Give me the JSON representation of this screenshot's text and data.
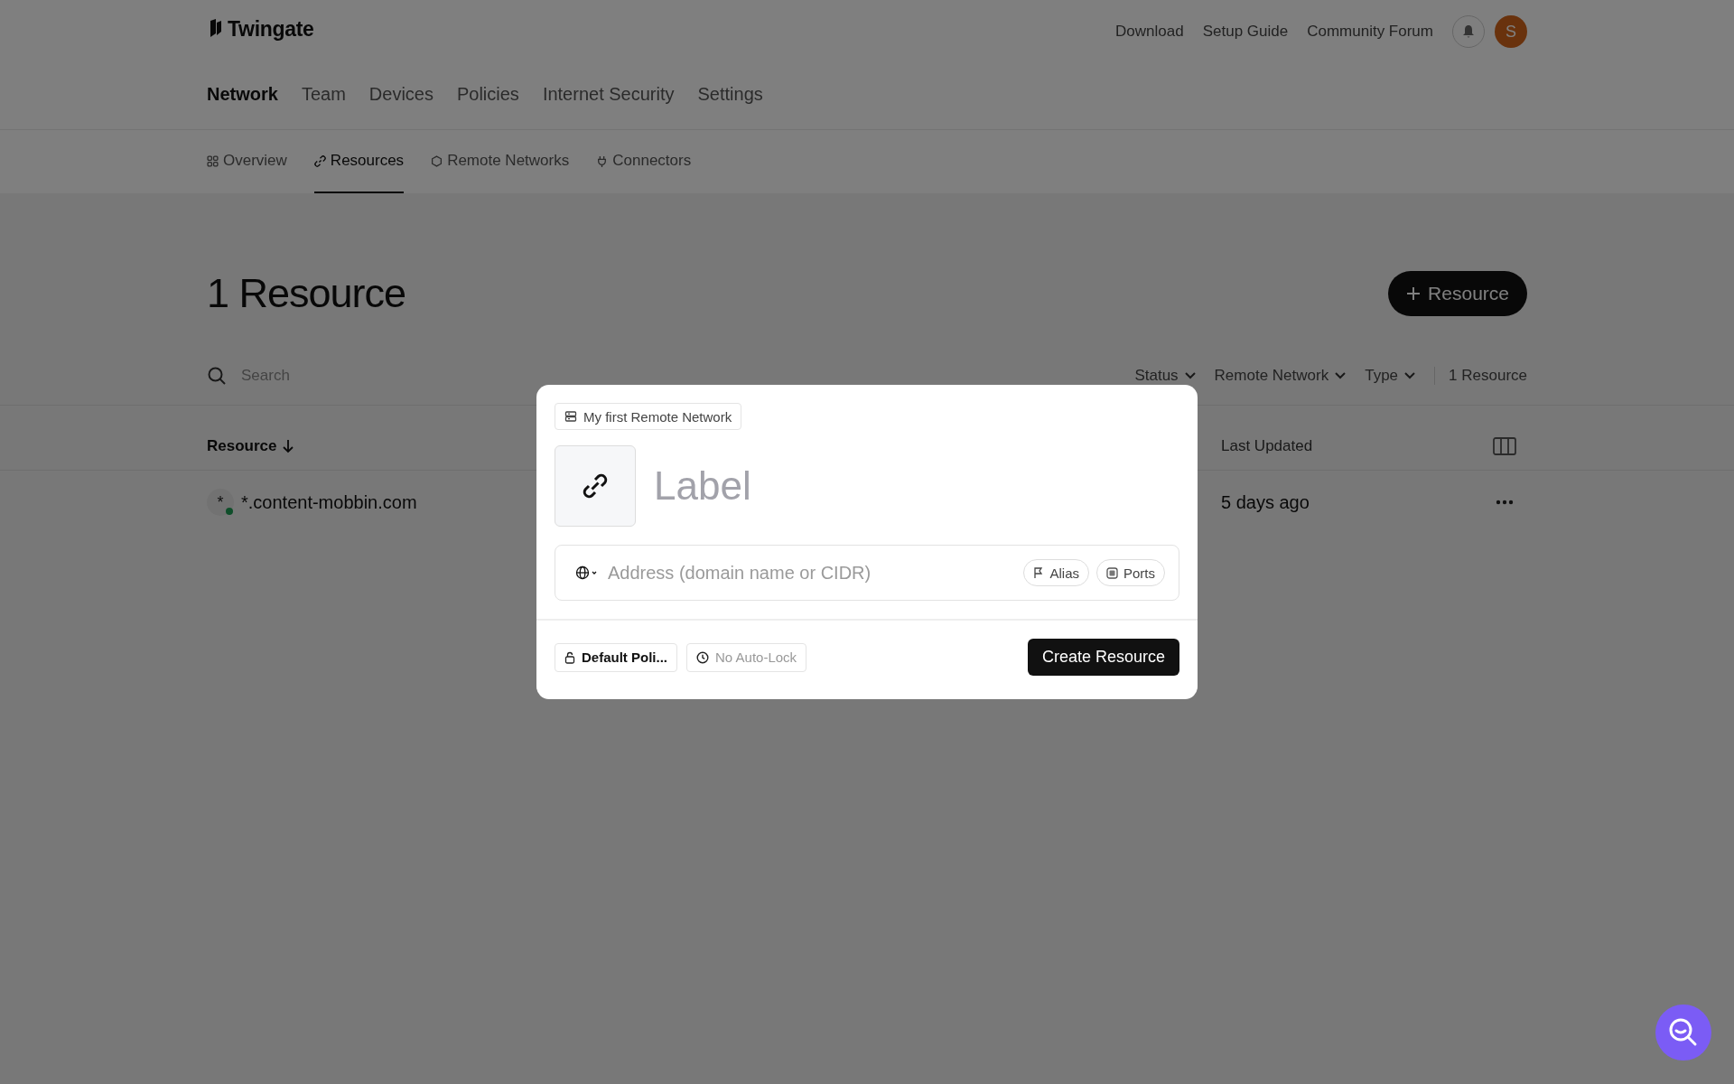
{
  "brand": {
    "name": "Twingate"
  },
  "top_links": [
    "Download",
    "Setup Guide",
    "Community Forum"
  ],
  "avatar": {
    "initial": "S"
  },
  "main_nav": [
    {
      "label": "Network",
      "selected": true
    },
    {
      "label": "Team",
      "selected": false
    },
    {
      "label": "Devices",
      "selected": false
    },
    {
      "label": "Policies",
      "selected": false
    },
    {
      "label": "Internet Security",
      "selected": false
    },
    {
      "label": "Settings",
      "selected": false
    }
  ],
  "sub_nav": [
    {
      "label": "Overview",
      "kind": "grid",
      "selected": false
    },
    {
      "label": "Resources",
      "kind": "link",
      "selected": true
    },
    {
      "label": "Remote Networks",
      "kind": "hexagon",
      "selected": false
    },
    {
      "label": "Connectors",
      "kind": "plug",
      "selected": false
    }
  ],
  "page": {
    "title": "1 Resource",
    "add_button": "Resource"
  },
  "filters": {
    "search_placeholder": "Search",
    "dropdowns": [
      "Status",
      "Remote Network",
      "Type"
    ],
    "count": "1 Resource"
  },
  "table": {
    "columns": [
      {
        "label": "Resource",
        "sorted": true
      },
      {
        "label": "Last Updated",
        "sorted": false
      }
    ],
    "rows": [
      {
        "symbol": "*",
        "resource": "*.content-mobbin.com",
        "online": true,
        "last_updated": "5 days ago"
      }
    ]
  },
  "modal": {
    "network": "My first Remote Network",
    "label_placeholder": "Label",
    "address_placeholder": "Address (domain name or CIDR)",
    "chips": [
      {
        "label": "Alias",
        "kind": "alias"
      },
      {
        "label": "Ports",
        "kind": "ports"
      }
    ],
    "policy": "Default Poli...",
    "auto_lock": "No Auto-Lock",
    "submit": "Create Resource"
  }
}
